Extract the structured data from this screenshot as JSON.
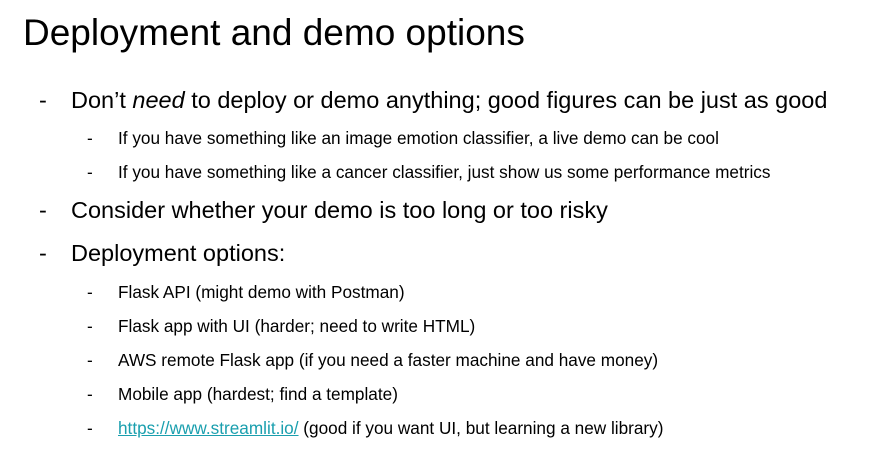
{
  "title": "Deployment and demo options",
  "bullet_marker": "-",
  "items": [
    {
      "pre": "Don’t ",
      "em": "need",
      "post": " to deploy or demo anything; good figures can be just as good"
    },
    {
      "text": "If you have something like an image emotion classifier, a live demo can be cool"
    },
    {
      "text": "If you have something like a cancer classifier, just show us some performance metrics"
    },
    {
      "text": "Consider whether your demo is too long or too risky"
    },
    {
      "text": "Deployment options:"
    },
    {
      "text": "Flask API (might demo with Postman)"
    },
    {
      "text": "Flask app with UI (harder; need to write HTML)"
    },
    {
      "text": "AWS remote Flask app (if you need a faster machine and have money)"
    },
    {
      "text": "Mobile app (hardest; find a template)"
    },
    {
      "link": "https://www.streamlit.io/",
      "post": " (good if you want UI, but learning a new library)"
    }
  ],
  "colors": {
    "text": "#000000",
    "link": "#1a9fae",
    "background": "#ffffff"
  }
}
